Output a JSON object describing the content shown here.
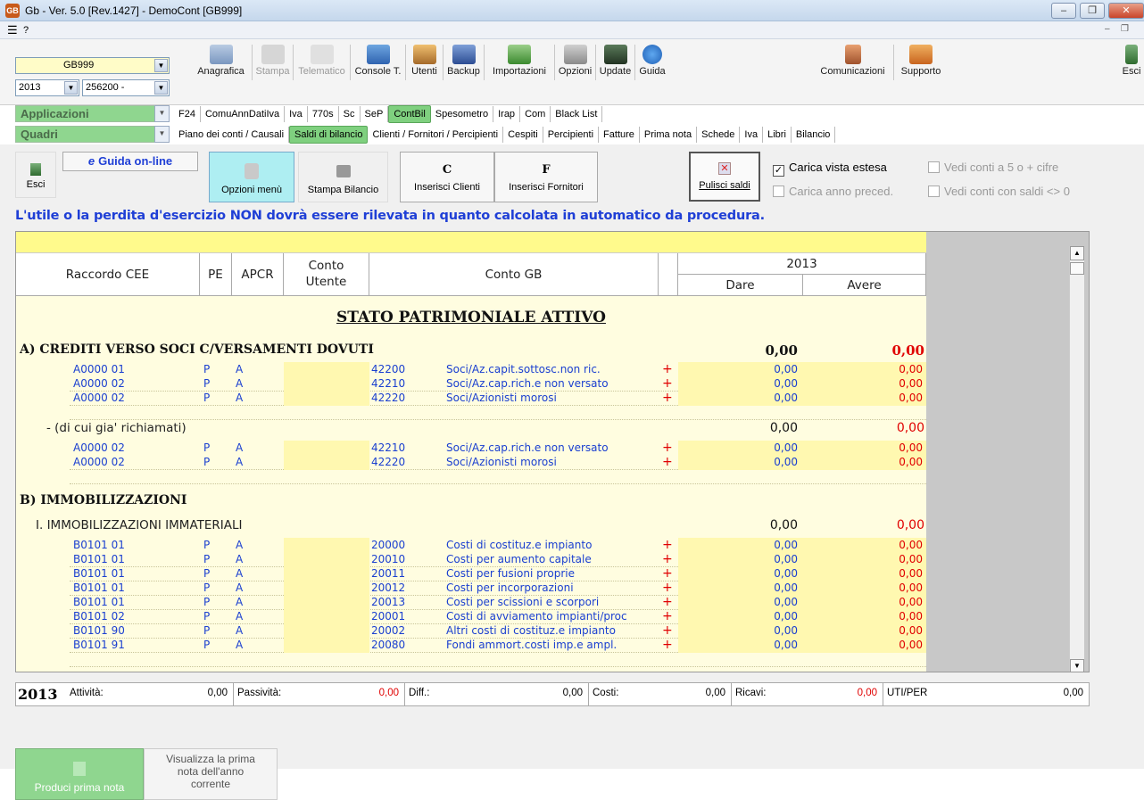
{
  "window": {
    "title": "Gb - Ver. 5.0 [Rev.1427] - DemoCont [GB999]",
    "app_icon": "GB"
  },
  "menubar": {
    "help": "?"
  },
  "combos": {
    "company": "GB999",
    "year": "2013",
    "code": "256200 -",
    "applicazioni": "Applicazioni",
    "quadri": "Quadri"
  },
  "toolbar": {
    "buttons": [
      "Anagrafica",
      "Stampa",
      "Telematico",
      "Console T.",
      "Utenti",
      "Backup",
      "Importazioni",
      "Opzioni",
      "Update",
      "Guida"
    ],
    "comunicazioni": "Comunicazioni",
    "supporto": "Supporto",
    "esci": "Esci"
  },
  "app_tabs": [
    "F24",
    "ComuAnnDatiIva",
    "Iva",
    "770s",
    "Sc",
    "SeP",
    "ContBil",
    "Spesometro",
    "Irap",
    "Com",
    "Black List"
  ],
  "quadri_tabs": [
    "Piano dei conti / Causali",
    "Saldi di bilancio",
    "Clienti / Fornitori / Percipienti",
    "Cespiti",
    "Percipienti",
    "Fatture",
    "Prima nota",
    "Schede",
    "Iva",
    "Libri",
    "Bilancio"
  ],
  "panel": {
    "esci": "Esci",
    "guida_online": "Guida on-line",
    "opzioni_menu": "Opzioni menù",
    "stampa_bilancio": "Stampa Bilancio",
    "inserisci_clienti": "Inserisci Clienti",
    "inserisci_fornitori": "Inserisci Fornitori",
    "pulisci_saldi": "Pulisci saldi",
    "carica_vista_estesa": "Carica vista estesa",
    "carica_anno_preced": "Carica anno preced.",
    "vedi_conti_5": "Vedi conti a 5 o + cifre",
    "vedi_conti_saldi": "Vedi conti con saldi <> 0"
  },
  "notice": "L'utile o la perdita d'esercizio NON dovrà essere rilevata in quanto calcolata in automatico da procedura.",
  "grid": {
    "headers": {
      "raccordo": "Raccordo CEE",
      "pe": "PE",
      "apcr": "APCR",
      "conto_utente": "Conto Utente",
      "conto_gb": "Conto GB",
      "year": "2013",
      "dare": "Dare",
      "avere": "Avere"
    },
    "title": "STATO PATRIMONIALE ATTIVO",
    "sectionA": {
      "label": "A) CREDITI VERSO SOCI C/VERSAMENTI DOVUTI",
      "dare": "0,00",
      "avere": "0,00"
    },
    "rowsA": [
      {
        "cee": "A0000 01",
        "pe": "P",
        "apcr": "A",
        "conto": "42200",
        "desc": "Soci/Az.capit.sottosc.non ric.",
        "sign": "+",
        "dare": "0,00",
        "avere": "0,00"
      },
      {
        "cee": "A0000 02",
        "pe": "P",
        "apcr": "A",
        "conto": "42210",
        "desc": "Soci/Az.cap.rich.e non versato",
        "sign": "+",
        "dare": "0,00",
        "avere": "0,00"
      },
      {
        "cee": "A0000 02",
        "pe": "P",
        "apcr": "A",
        "conto": "42220",
        "desc": "Soci/Azionisti morosi",
        "sign": "+",
        "dare": "0,00",
        "avere": "0,00"
      }
    ],
    "subA": {
      "label": "- (di cui gia' richiamati)",
      "dare": "0,00",
      "avere": "0,00"
    },
    "rowsA2": [
      {
        "cee": "A0000 02",
        "pe": "P",
        "apcr": "A",
        "conto": "42210",
        "desc": "Soci/Az.cap.rich.e non versato",
        "sign": "+",
        "dare": "0,00",
        "avere": "0,00"
      },
      {
        "cee": "A0000 02",
        "pe": "P",
        "apcr": "A",
        "conto": "42220",
        "desc": "Soci/Azionisti morosi",
        "sign": "+",
        "dare": "0,00",
        "avere": "0,00"
      }
    ],
    "sectionB": {
      "label": "B) IMMOBILIZZAZIONI"
    },
    "subB": {
      "label": "I. IMMOBILIZZAZIONI IMMATERIALI",
      "dare": "0,00",
      "avere": "0,00"
    },
    "rowsB": [
      {
        "cee": "B0101 01",
        "pe": "P",
        "apcr": "A",
        "conto": "20000",
        "desc": "Costi di costituz.e impianto",
        "sign": "+",
        "dare": "0,00",
        "avere": "0,00"
      },
      {
        "cee": "B0101 01",
        "pe": "P",
        "apcr": "A",
        "conto": "20010",
        "desc": "Costi per aumento capitale",
        "sign": "+",
        "dare": "0,00",
        "avere": "0,00"
      },
      {
        "cee": "B0101 01",
        "pe": "P",
        "apcr": "A",
        "conto": "20011",
        "desc": "Costi per fusioni proprie",
        "sign": "+",
        "dare": "0,00",
        "avere": "0,00"
      },
      {
        "cee": "B0101 01",
        "pe": "P",
        "apcr": "A",
        "conto": "20012",
        "desc": "Costi per incorporazioni",
        "sign": "+",
        "dare": "0,00",
        "avere": "0,00"
      },
      {
        "cee": "B0101 01",
        "pe": "P",
        "apcr": "A",
        "conto": "20013",
        "desc": "Costi per scissioni e scorpori",
        "sign": "+",
        "dare": "0,00",
        "avere": "0,00"
      },
      {
        "cee": "B0101 02",
        "pe": "P",
        "apcr": "A",
        "conto": "20001",
        "desc": "Costi di avviamento impianti/proc",
        "sign": "+",
        "dare": "0,00",
        "avere": "0,00"
      },
      {
        "cee": "B0101 90",
        "pe": "P",
        "apcr": "A",
        "conto": "20002",
        "desc": "Altri costi di costituz.e impianto",
        "sign": "+",
        "dare": "0,00",
        "avere": "0,00"
      },
      {
        "cee": "B0101 91",
        "pe": "P",
        "apcr": "A",
        "conto": "20080",
        "desc": "Fondi ammort.costi imp.e ampl.",
        "sign": "+",
        "dare": "0,00",
        "avere": "0,00"
      }
    ]
  },
  "status": {
    "year": "2013",
    "attivita_label": "Attività:",
    "attivita": "0,00",
    "passivita_label": "Passività:",
    "passivita": "0,00",
    "diff_label": "Diff.:",
    "diff": "0,00",
    "costi_label": "Costi:",
    "costi": "0,00",
    "ricavi_label": "Ricavi:",
    "ricavi": "0,00",
    "utiper_label": "UTI/PER",
    "utiper": "0,00"
  },
  "bottom": {
    "produci": "Produci prima nota",
    "visualizza": "Visualizza la prima nota dell'anno corrente"
  },
  "colors": {
    "accent_blue": "#1f3fd6",
    "red": "#e00000",
    "green": "#8fd68f",
    "grid_bg": "#fffde0"
  }
}
